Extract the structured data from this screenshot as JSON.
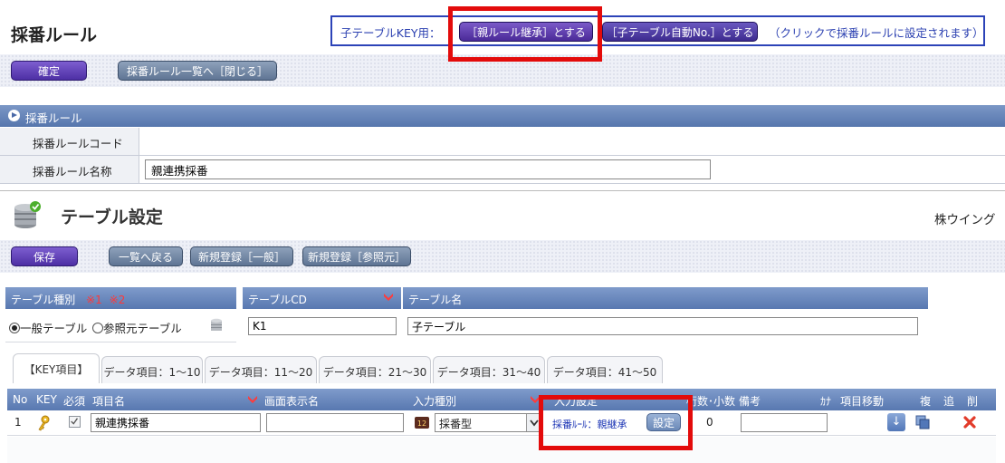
{
  "numbering_rule": {
    "title": "採番ルール",
    "hint": {
      "prefix": "子テーブルKEY用：",
      "btn_inherit": "［親ルール継承］とする",
      "btn_auto": "［子テーブル自動No.］とする",
      "note": "（クリックで採番ルールに設定されます）"
    },
    "confirm_label": "確定",
    "back_label": "採番ルール一覧へ［閉じる］",
    "section_label": "採番ルール",
    "fields": [
      {
        "label": "採番ルールコード",
        "value": ""
      },
      {
        "label": "採番ルール名称",
        "value": "親連携採番"
      }
    ]
  },
  "table_settings": {
    "title": "テーブル設定",
    "company": "株ウイング",
    "toolbar": {
      "save": "保存",
      "back": "一覧へ戻る",
      "new_general": "新規登録［一般］",
      "new_ref": "新規登録［参照元］"
    },
    "table_type": {
      "header": "テーブル種別",
      "mark1": "※1",
      "mark2": "※2",
      "opt_general": "一般テーブル",
      "opt_ref": "参照元テーブル",
      "selected": "一般テーブル"
    },
    "table_cd": {
      "header": "テーブルCD",
      "value": "K1"
    },
    "table_name": {
      "header": "テーブル名",
      "value": "子テーブル"
    },
    "tabs": [
      "【KEY項目】",
      "データ項目：1〜10",
      "データ項目：11〜20",
      "データ項目：21〜30",
      "データ項目：31〜40",
      "データ項目：41〜50"
    ],
    "grid_headers": {
      "no": "No",
      "key": "KEY",
      "required": "必須",
      "item_name": "項目名",
      "display_name": "画面表示名",
      "input_type": "入力種別",
      "input_settings": "入力設定",
      "digits": "桁数･小数",
      "note": "備考",
      "kana": "ｶﾅ",
      "move": "項目移動",
      "copy": "複",
      "add": "追",
      "delete": "削"
    },
    "row": {
      "no": "1",
      "required_checked": true,
      "item_name": "親連携採番",
      "display_name": "",
      "input_type": "採番型",
      "rule_text": "採番ﾙｰﾙ：親継承",
      "set_label": "設定",
      "digits": "0",
      "note": ""
    }
  },
  "highlight_color": "#e30b0b"
}
